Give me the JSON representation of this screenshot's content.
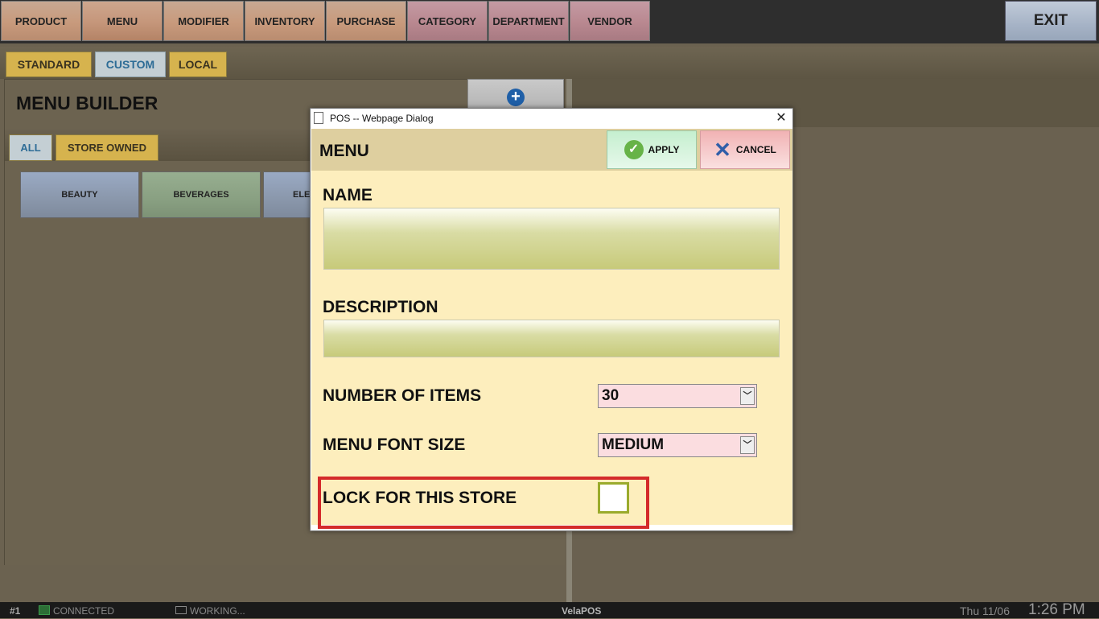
{
  "nav": {
    "items": [
      "PRODUCT",
      "MENU",
      "MODIFIER",
      "INVENTORY",
      "PURCHASE",
      "CATEGORY",
      "DEPARTMENT",
      "VENDOR"
    ],
    "exit_label": "EXIT"
  },
  "tabs": [
    "STANDARD",
    "CUSTOM",
    "LOCAL"
  ],
  "menu_builder": {
    "title": "MENU BUILDER",
    "subtabs": [
      "ALL",
      "STORE OWNED"
    ],
    "categories": [
      "BEAUTY",
      "BEVERAGES",
      "ELEC"
    ]
  },
  "dialog": {
    "window_title": "POS -- Webpage Dialog",
    "header": "MENU",
    "apply_label": "APPLY",
    "cancel_label": "CANCEL",
    "name_label": "NAME",
    "name_value": "",
    "description_label": "DESCRIPTION",
    "description_value": "",
    "items_label": "NUMBER OF ITEMS",
    "items_value": "30",
    "font_label": "MENU FONT SIZE",
    "font_value": "MEDIUM",
    "lock_label": "LOCK FOR THIS STORE",
    "lock_checked": false
  },
  "status": {
    "station": "#1",
    "connected": "CONNECTED",
    "working": "WORKING...",
    "brand": "VelaPOS",
    "date": "Thu 11/06",
    "time": "1:26 PM"
  },
  "colors": {
    "highlight_border": "#d42a2a",
    "dialog_bg": "#fdeebd",
    "tab_gold": "#d6b34e",
    "tab_selected": "#c4cfd4"
  }
}
